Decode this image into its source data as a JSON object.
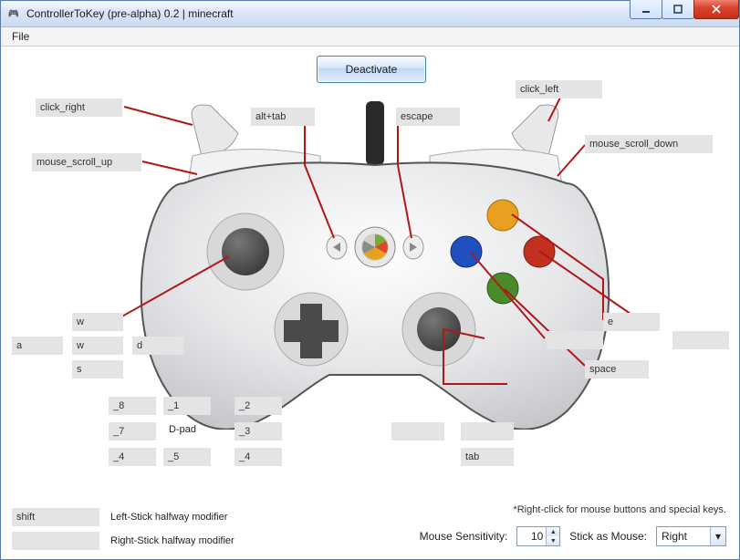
{
  "window": {
    "title": "ControllerToKey (pre-alpha) 0.2 | minecraft"
  },
  "menu": {
    "file": "File"
  },
  "main": {
    "deactivate": "Deactivate"
  },
  "labels": {
    "click_right": "click_right",
    "click_left": "click_left",
    "alt_tab": "alt+tab",
    "escape": "escape",
    "mouse_scroll_up": "mouse_scroll_up",
    "mouse_scroll_down": "mouse_scroll_down",
    "y_button": "",
    "b_button": "e",
    "x_button": "",
    "a_button": "space",
    "ls_up": "w",
    "ls_left": "a",
    "ls_center": "w",
    "ls_right": "d",
    "ls_down": "s",
    "dpad_ul": "_8",
    "dpad_u": "_1",
    "dpad_ur": "_2",
    "dpad_l": "_7",
    "dpad_caption": "D-pad",
    "dpad_r": "_3",
    "dpad_dl": "_4",
    "dpad_d": "_5",
    "dpad_dr": "_4",
    "rs_click": "",
    "rs_up": "",
    "rs_down_label": "tab",
    "extra_right_1": "",
    "extra_right_2": ""
  },
  "modifiers": {
    "left_value": "shift",
    "left_caption": "Left-Stick halfway modifier",
    "right_value": "",
    "right_caption": "Right-Stick halfway modifier"
  },
  "footer": {
    "hint": "*Right-click for mouse buttons and special keys.",
    "mouse_sensitivity_label": "Mouse Sensitivity:",
    "mouse_sensitivity_value": "10",
    "stick_as_mouse_label": "Stick as Mouse:",
    "stick_as_mouse_value": "Right"
  }
}
